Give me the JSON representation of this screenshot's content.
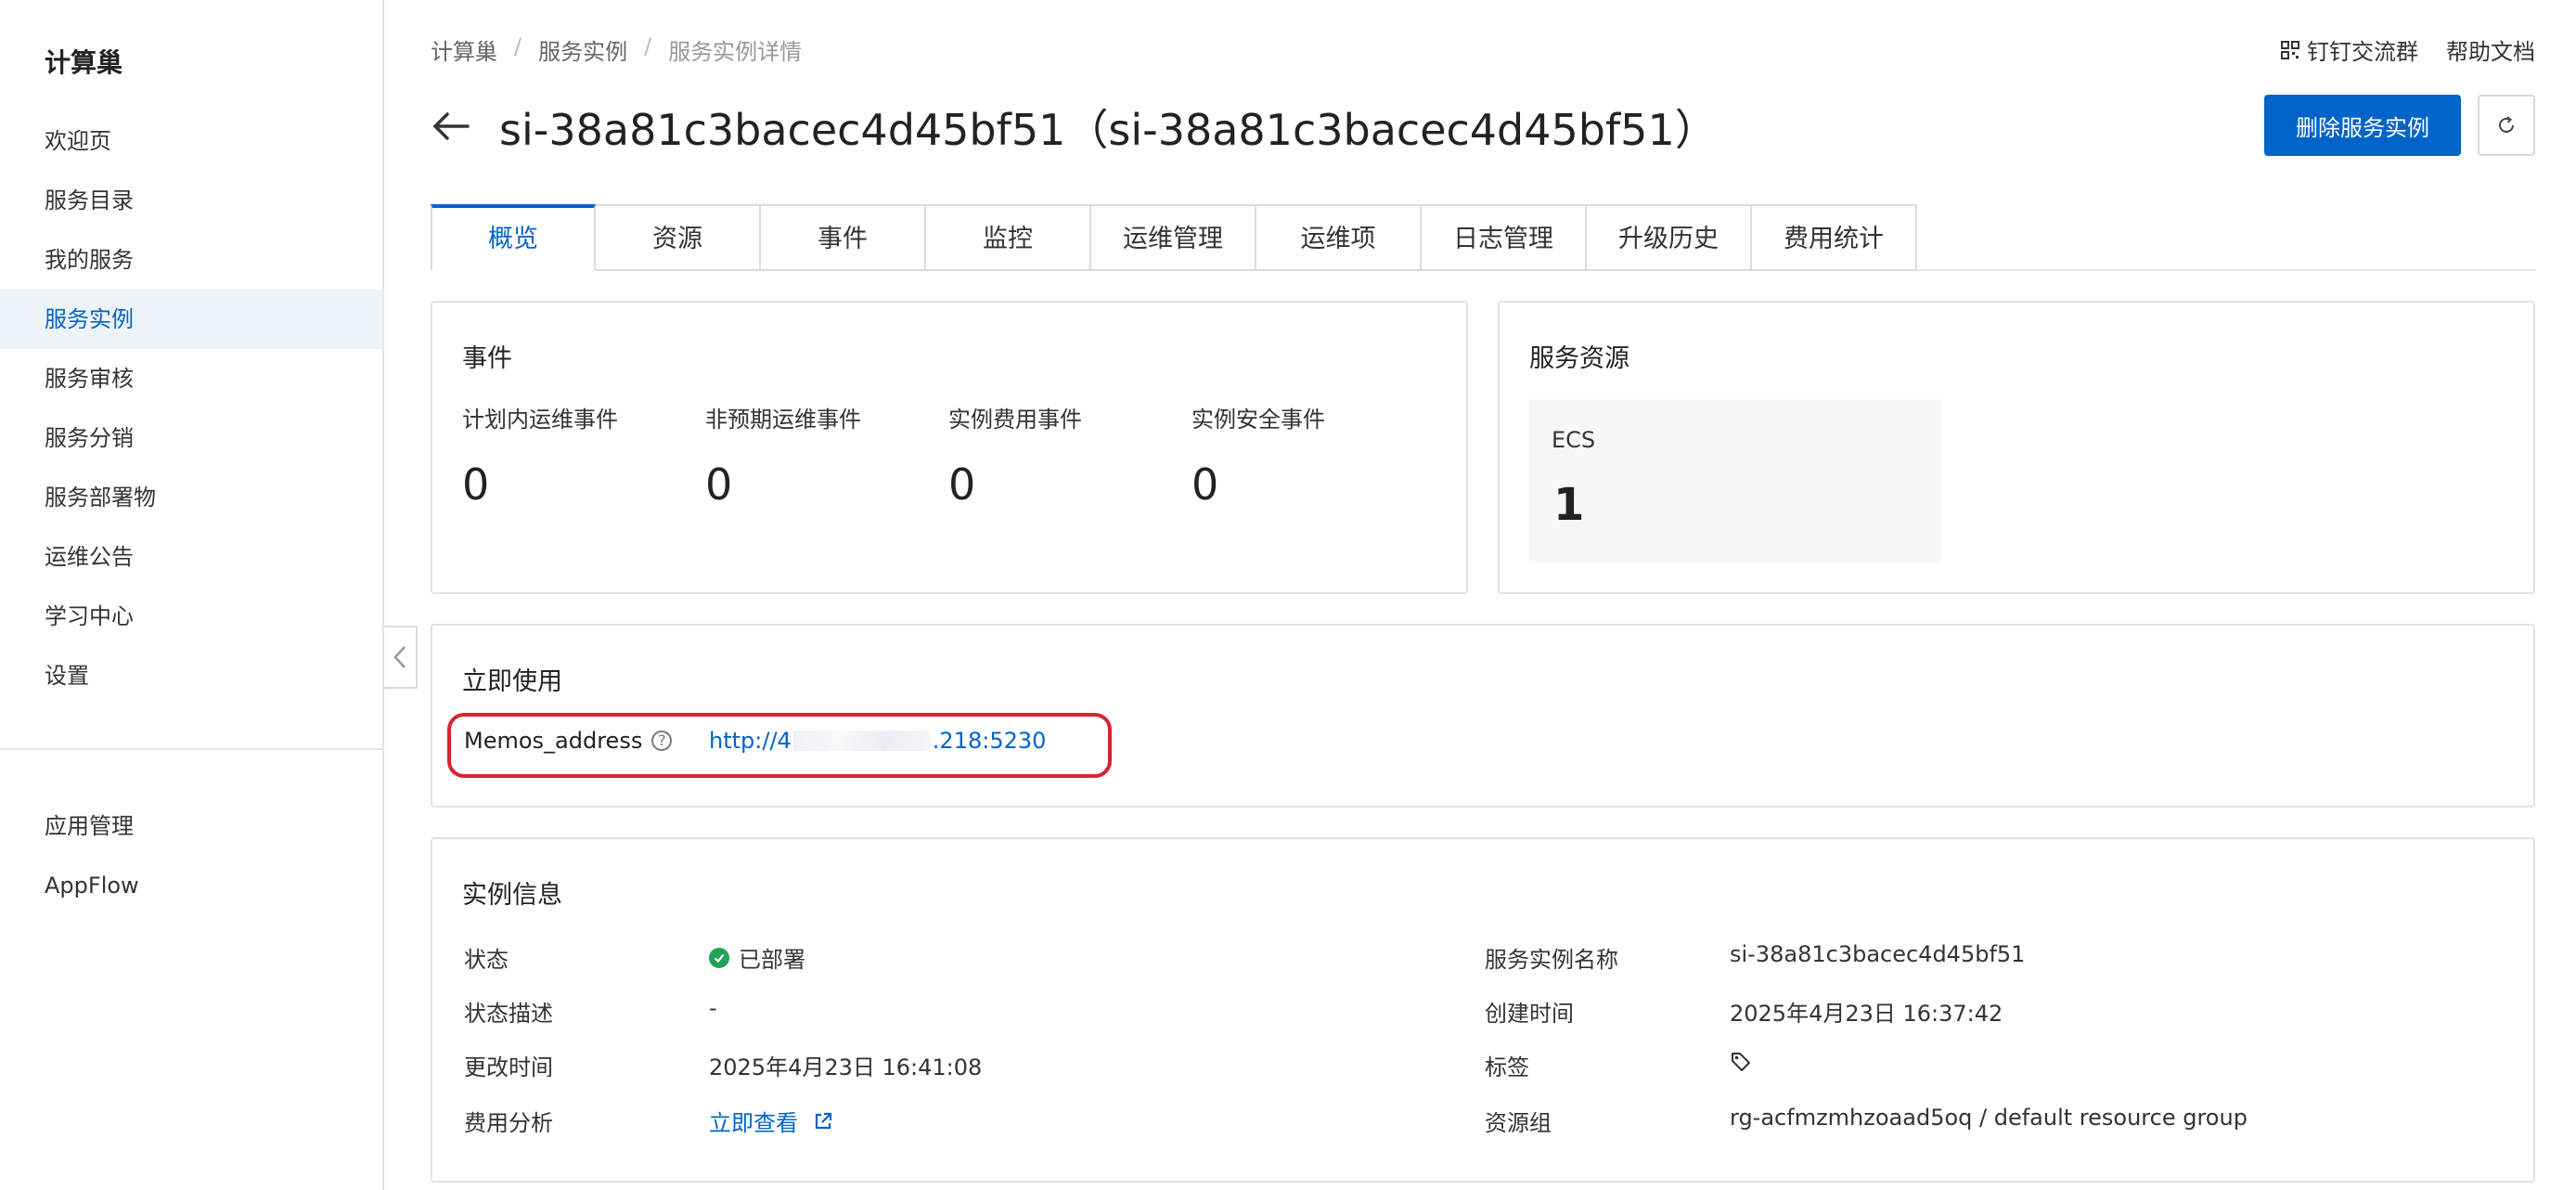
{
  "sidebar": {
    "title": "计算巢",
    "items": [
      {
        "label": "欢迎页"
      },
      {
        "label": "服务目录"
      },
      {
        "label": "我的服务"
      },
      {
        "label": "服务实例"
      },
      {
        "label": "服务审核"
      },
      {
        "label": "服务分销"
      },
      {
        "label": "服务部署物"
      },
      {
        "label": "运维公告"
      },
      {
        "label": "学习中心"
      },
      {
        "label": "设置"
      }
    ],
    "bottom_items": [
      {
        "label": "应用管理"
      },
      {
        "label": "AppFlow"
      }
    ],
    "active_item": "服务实例"
  },
  "breadcrumb": [
    "计算巢",
    "服务实例",
    "服务实例详情"
  ],
  "top_links": {
    "dingtalk": "钉钉交流群",
    "help": "帮助文档"
  },
  "header": {
    "title": "si-38a81c3bacec4d45bf51（si-38a81c3bacec4d45bf51）",
    "delete_button": "删除服务实例"
  },
  "tabs": [
    "概览",
    "资源",
    "事件",
    "监控",
    "运维管理",
    "运维项",
    "日志管理",
    "升级历史",
    "费用统计"
  ],
  "active_tab": "概览",
  "events": {
    "title": "事件",
    "items": [
      {
        "label": "计划内运维事件",
        "value": "0"
      },
      {
        "label": "非预期运维事件",
        "value": "0"
      },
      {
        "label": "实例费用事件",
        "value": "0"
      },
      {
        "label": "实例安全事件",
        "value": "0"
      }
    ]
  },
  "resources": {
    "title": "服务资源",
    "items": [
      {
        "label": "ECS",
        "value": "1"
      }
    ]
  },
  "use_now": {
    "title": "立即使用",
    "label": "Memos_address",
    "link_prefix": "http://4",
    "link_suffix": ".218:5230"
  },
  "instance_info": {
    "title": "实例信息",
    "left": [
      {
        "label": "状态",
        "value": "已部署"
      },
      {
        "label": "状态描述",
        "value": "-"
      },
      {
        "label": "更改时间",
        "value": "2025年4月23日 16:41:08"
      },
      {
        "label": "费用分析",
        "value": "立即查看"
      }
    ],
    "right": [
      {
        "label": "服务实例名称",
        "value": "si-38a81c3bacec4d45bf51"
      },
      {
        "label": "创建时间",
        "value": "2025年4月23日 16:37:42"
      },
      {
        "label": "标签",
        "value": ""
      },
      {
        "label": "资源组",
        "value": "rg-acfmzmhzoaad5oq / default resource group"
      }
    ]
  },
  "colors": {
    "accent": "#0064c8",
    "highlight": "#d9232f",
    "success": "#23a155"
  }
}
